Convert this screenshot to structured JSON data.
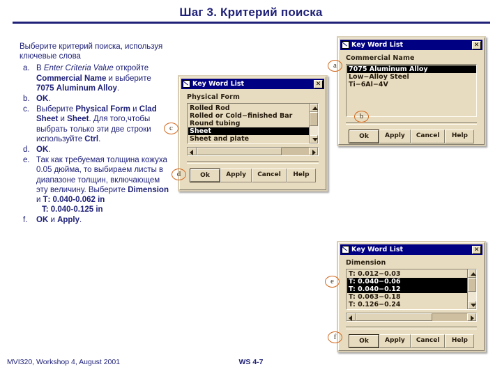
{
  "slide": {
    "title": "Шаг 3.  Критерий поиска",
    "footer_left": "MVI320, Workshop 4, August 2001",
    "footer_center": "WS 4-7"
  },
  "instructions": {
    "intro": "Выберите критерий поиска, используя ключевые слова",
    "steps": [
      {
        "marker": "a.",
        "text": "В Enter Criteria Value откройте  Commercial Name и выберите 7075 Aluminum Alloy."
      },
      {
        "marker": "b.",
        "text": "OK."
      },
      {
        "marker": "c.",
        "text": "Выберите Physical Form и Clad Sheet и Sheet.  Для того,чтобы выбрать только эти две строки используйте Ctrl."
      },
      {
        "marker": "d.",
        "text": "OK."
      },
      {
        "marker": "e.",
        "text": "Так как требуемая толщина кожуха 0.05 дюйма, то выбираем листы в диапазоне толщин, включающем эту величину.  Выберите Dimension и Т: 0.040-0.062 in"
      },
      {
        "marker": "e_sub",
        "text": "T: 0.040-0.125 in"
      },
      {
        "marker": "f.",
        "text": "OK и Apply."
      }
    ]
  },
  "callouts": {
    "a": "a",
    "b": "b",
    "c": "c",
    "d": "d",
    "e": "e",
    "f": "f"
  },
  "dialog_commercial": {
    "title": "Key Word List",
    "close_label": "✕",
    "field_label": "Commercial Name",
    "items": [
      {
        "text": "7075 Aluminum Alloy",
        "selected": true
      },
      {
        "text": "Low−Alloy Steel",
        "selected": false
      },
      {
        "text": "Ti−6Al−4V",
        "selected": false
      }
    ],
    "buttons": [
      "Ok",
      "Apply",
      "Cancel",
      "Help"
    ]
  },
  "dialog_physical_form": {
    "title": "Key Word List",
    "close_label": "✕",
    "field_label": "Physical Form",
    "items": [
      {
        "text": "Rolled Rod",
        "selected": false
      },
      {
        "text": "Rolled or Cold−finished Bar",
        "selected": false
      },
      {
        "text": "Round tubing",
        "selected": false
      },
      {
        "text": "Sheet",
        "selected": true
      },
      {
        "text": "Sheet and plate",
        "selected": false
      }
    ],
    "buttons": [
      "Ok",
      "Apply",
      "Cancel",
      "Help"
    ]
  },
  "dialog_dimension": {
    "title": "Key Word List",
    "close_label": "✕",
    "field_label": "Dimension",
    "items": [
      {
        "text": "T: 0.012−0.03",
        "selected": false
      },
      {
        "text": "T: 0.040−0.06",
        "selected": true
      },
      {
        "text": "T: 0.040−0.12",
        "selected": true
      },
      {
        "text": "T: 0.063−0.18",
        "selected": false
      },
      {
        "text": "T: 0.126−0.24",
        "selected": false
      }
    ],
    "buttons": [
      "Ok",
      "Apply",
      "Cancel",
      "Help"
    ]
  },
  "colors": {
    "slide_text": "#1f2178",
    "titlebar": "#000082",
    "dialog_face": "#e8dcc0",
    "callout_ring": "#d2691e",
    "selection": "#000000"
  }
}
